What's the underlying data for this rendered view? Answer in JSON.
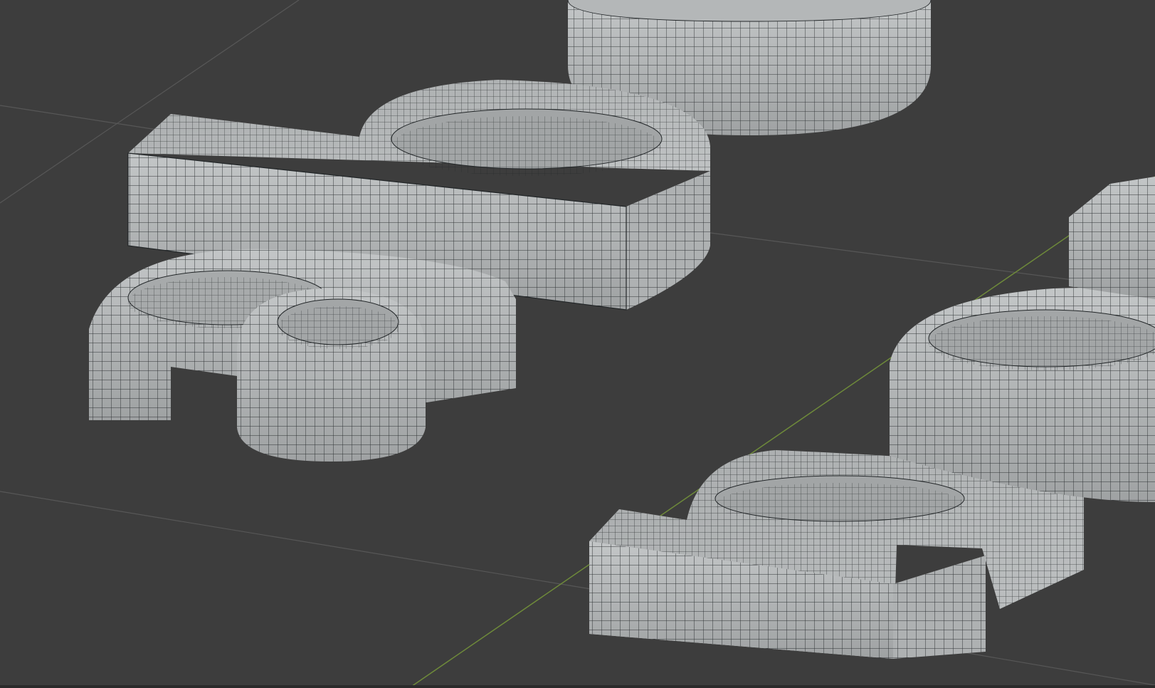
{
  "viewport": {
    "background_color": "#3d3d3d",
    "grid_line_color": "#575757",
    "axis_line_color": "#6e8a3a",
    "mesh_fill_light": "#b9bcbd",
    "mesh_fill_mid": "#a4a7a8",
    "mesh_fill_dark": "#8c8f90",
    "wire_color": "#222628",
    "objects": [
      {
        "name": "letter-mesh-arch-top",
        "shape": "ring-extrusion"
      },
      {
        "name": "letter-mesh-n-left",
        "shape": "n-glyph-extrusion"
      },
      {
        "name": "letter-mesh-a-left",
        "shape": "a-glyph-extrusion"
      },
      {
        "name": "letter-mesh-n-right",
        "shape": "n-glyph-extrusion"
      },
      {
        "name": "letter-mesh-o-right",
        "shape": "ring-extrusion"
      },
      {
        "name": "letter-mesh-edge-right",
        "shape": "stem-extrusion"
      }
    ]
  }
}
